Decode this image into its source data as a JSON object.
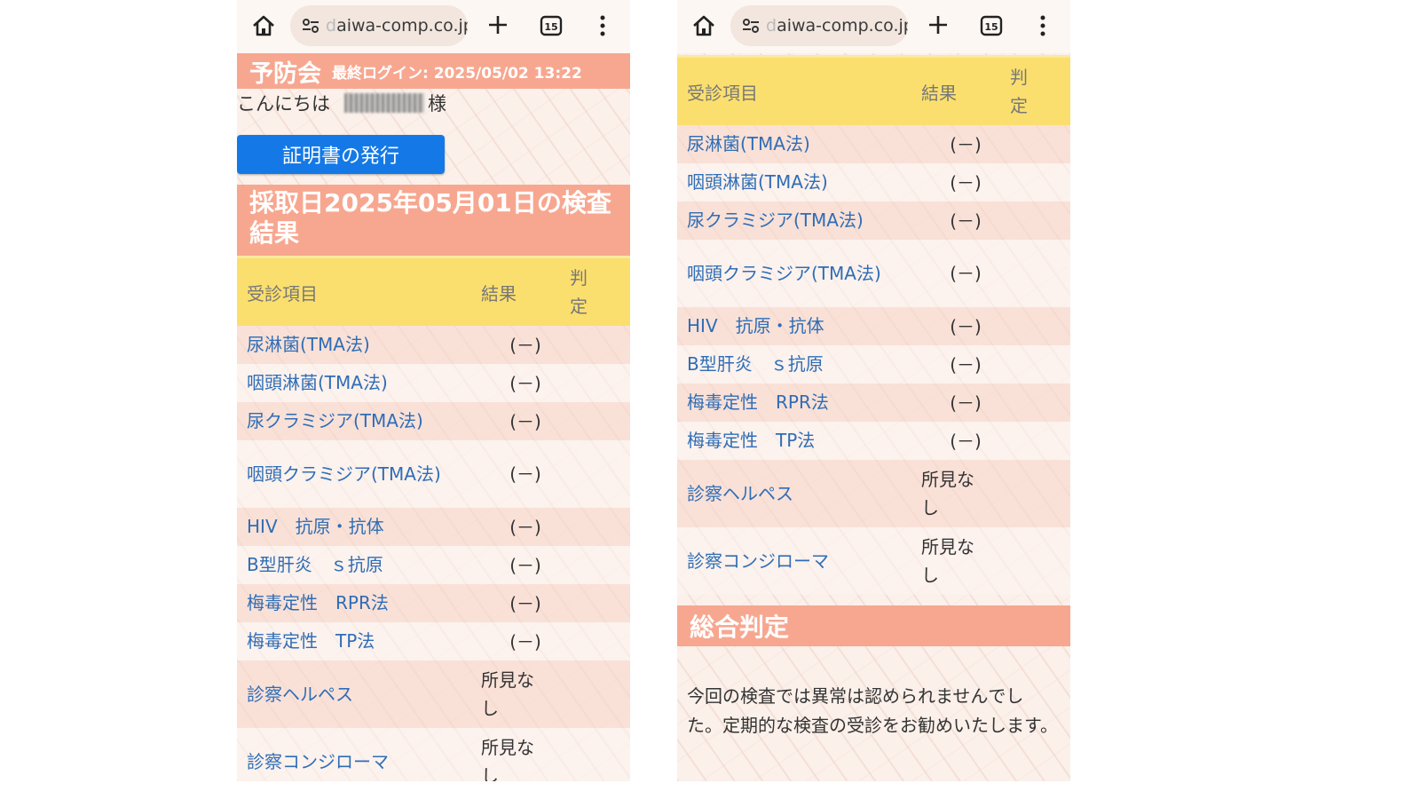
{
  "browser": {
    "url_fade": "d",
    "url": "aiwa-comp.co.jp",
    "tab_count": "15"
  },
  "page": {
    "brand": "予防会",
    "last_login": "最終ログイン: 2025/05/02 13:22",
    "greeting": "こんにちは",
    "honorific": "様",
    "cert_button": "証明書の発行",
    "section_title": "採取日2025年05月01日の検査結果",
    "columns": {
      "item": "受診項目",
      "result": "結果",
      "judgement": "判定"
    },
    "rows": [
      {
        "item": "尿淋菌(TMA法)",
        "result": "(－)"
      },
      {
        "item": "咽頭淋菌(TMA法)",
        "result": "(－)"
      },
      {
        "item": "尿クラミジア(TMA法)",
        "result": "(－)"
      },
      {
        "item": "咽頭クラミジア(TMA法)",
        "result": "(－)"
      },
      {
        "item": "HIV　抗原・抗体",
        "result": "(－)"
      },
      {
        "item": "B型肝炎　ｓ抗原",
        "result": "(－)"
      },
      {
        "item": "梅毒定性　RPR法",
        "result": "(－)"
      },
      {
        "item": "梅毒定性　TP法",
        "result": "(－)"
      },
      {
        "item": "診察ヘルペス",
        "result": "所見なし"
      },
      {
        "item": "診察コンジローマ",
        "result": "所見なし"
      }
    ],
    "summary_title": "総合判定",
    "summary_text": "今回の検査では異常は認められませんでした。定期的な検査の受診をお勧めいたします。"
  }
}
